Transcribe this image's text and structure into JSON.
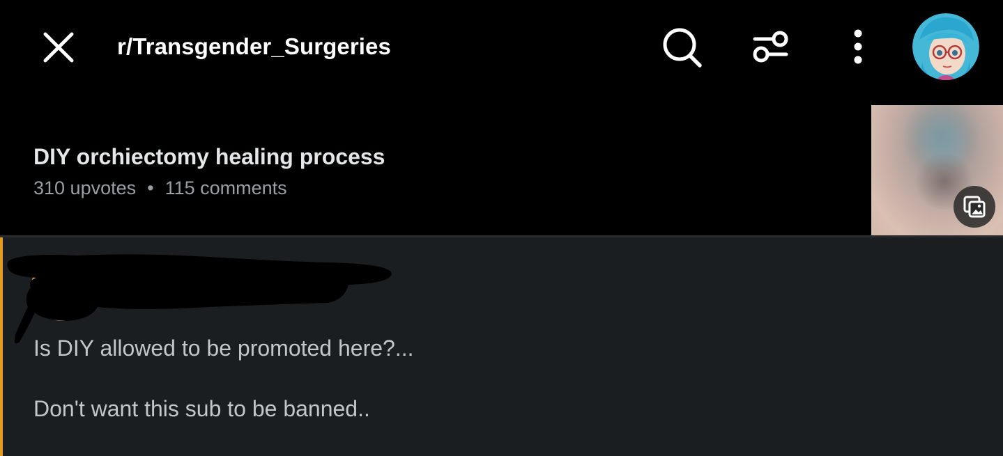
{
  "header": {
    "subreddit": "r/Transgender_Surgeries",
    "icons": {
      "close": "close-icon",
      "search": "search-icon",
      "filter": "filter-icon",
      "more": "more-vertical-icon",
      "avatar": "user-avatar"
    }
  },
  "post": {
    "title": "DIY orchiectomy healing process",
    "upvotes": "310 upvotes",
    "separator": "•",
    "comments": "115 comments",
    "thumbnail_badge_icon": "gallery-icon"
  },
  "comment": {
    "author_redacted": true,
    "lines": [
      "Is DIY allowed to be promoted here?...",
      "Don't want this sub to be banned.."
    ],
    "accent_color": "#e29a1f"
  },
  "colors": {
    "background": "#000000",
    "comment_background": "#1a1e21",
    "title_text": "#e4e6e8",
    "meta_text": "#9a9fa3"
  }
}
